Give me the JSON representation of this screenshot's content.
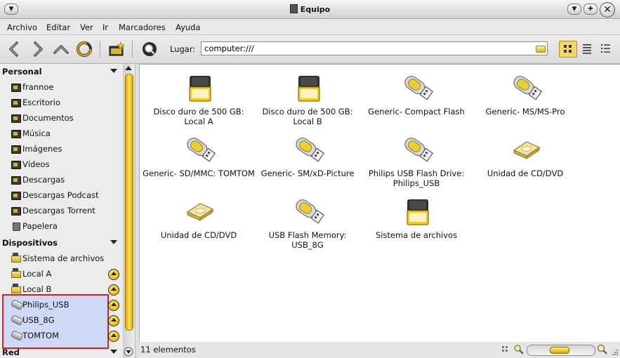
{
  "window": {
    "title": "Equipo"
  },
  "menubar": {
    "items": [
      "Archivo",
      "Editar",
      "Ver",
      "Ir",
      "Marcadores",
      "Ayuda"
    ]
  },
  "toolbar": {
    "location_label": "Lugar:",
    "location_value": "computer:///"
  },
  "sidebar": {
    "personal": {
      "header": "Personal",
      "items": [
        {
          "label": "frannoe",
          "icon": "home-folder-icon"
        },
        {
          "label": "Escritorio",
          "icon": "desktop-folder-icon"
        },
        {
          "label": "Documentos",
          "icon": "documents-folder-icon"
        },
        {
          "label": "Música",
          "icon": "music-folder-icon"
        },
        {
          "label": "Imágenes",
          "icon": "pictures-folder-icon"
        },
        {
          "label": "Vídeos",
          "icon": "videos-folder-icon"
        },
        {
          "label": "Descargas",
          "icon": "downloads-folder-icon"
        },
        {
          "label": "Descargas Podcast",
          "icon": "folder-icon"
        },
        {
          "label": "Descargas Torrent",
          "icon": "folder-icon"
        },
        {
          "label": "Papelera",
          "icon": "trash-icon"
        }
      ]
    },
    "devices": {
      "header": "Dispositivos",
      "items": [
        {
          "label": "Sistema de archivos",
          "icon": "harddisk-icon",
          "eject": false
        },
        {
          "label": "Local A",
          "icon": "harddisk-icon",
          "eject": true
        },
        {
          "label": "Local B",
          "icon": "harddisk-icon",
          "eject": true
        },
        {
          "label": "Philips_USB",
          "icon": "usb-drive-icon",
          "eject": true
        },
        {
          "label": "USB_8G",
          "icon": "usb-drive-icon",
          "eject": true
        },
        {
          "label": "TOMTOM",
          "icon": "usb-drive-icon",
          "eject": true
        }
      ]
    },
    "network": {
      "header": "Red"
    }
  },
  "main": {
    "items": [
      {
        "label": "Disco duro de 500 GB: Local A",
        "icon": "harddisk-icon"
      },
      {
        "label": "Disco duro de 500 GB: Local B",
        "icon": "harddisk-icon"
      },
      {
        "label": "Generic- Compact Flash",
        "icon": "usb-drive-icon"
      },
      {
        "label": "Generic- MS/MS-Pro",
        "icon": "usb-drive-icon"
      },
      {
        "label": "Generic- SD/MMC: TOMTOM",
        "icon": "usb-drive-icon"
      },
      {
        "label": "Generic- SM/xD-Picture",
        "icon": "usb-drive-icon"
      },
      {
        "label": "Philips USB Flash Drive: Philips_USB",
        "icon": "usb-drive-icon"
      },
      {
        "label": "Unidad de CD/DVD",
        "icon": "optical-drive-icon"
      },
      {
        "label": "Unidad de CD/DVD",
        "icon": "optical-drive-icon"
      },
      {
        "label": "USB Flash Memory: USB_8G",
        "icon": "usb-drive-icon"
      },
      {
        "label": "Sistema de archivos",
        "icon": "harddisk-icon"
      }
    ]
  },
  "statusbar": {
    "text": "11 elementos",
    "zoom_level": 0.45
  },
  "colors": {
    "accent": "#e8c22a",
    "selection": "#cfd8f6",
    "annotation_border": "#d92020"
  }
}
